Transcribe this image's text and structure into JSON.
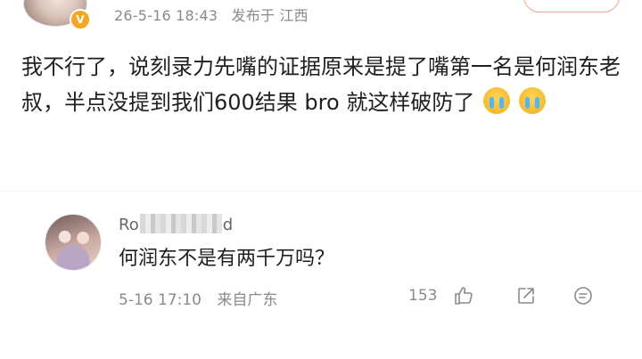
{
  "post": {
    "author_badge": "V",
    "timestamp": "26-5-16 18:43",
    "location_prefix": "发布于",
    "location": "江西",
    "text": "我不行了，说刻录力先嘴的证据原来是提了嘴第一名是何润东老叔，半点没提到我们600结果 bro 就这样破防了",
    "emoji_count": 2
  },
  "comment": {
    "user_name_start": "Ro",
    "user_name_end": "d",
    "text": "何润东不是有两千万吗？",
    "date": "5-16 17:10",
    "source": "来自广东",
    "like_count": "153"
  },
  "icons": [
    "like-icon",
    "share-icon",
    "comment-icon"
  ],
  "colors": {
    "meta_text": "#8a8a8a",
    "follow_border": "#f3a683",
    "badge": "#f5a623"
  }
}
